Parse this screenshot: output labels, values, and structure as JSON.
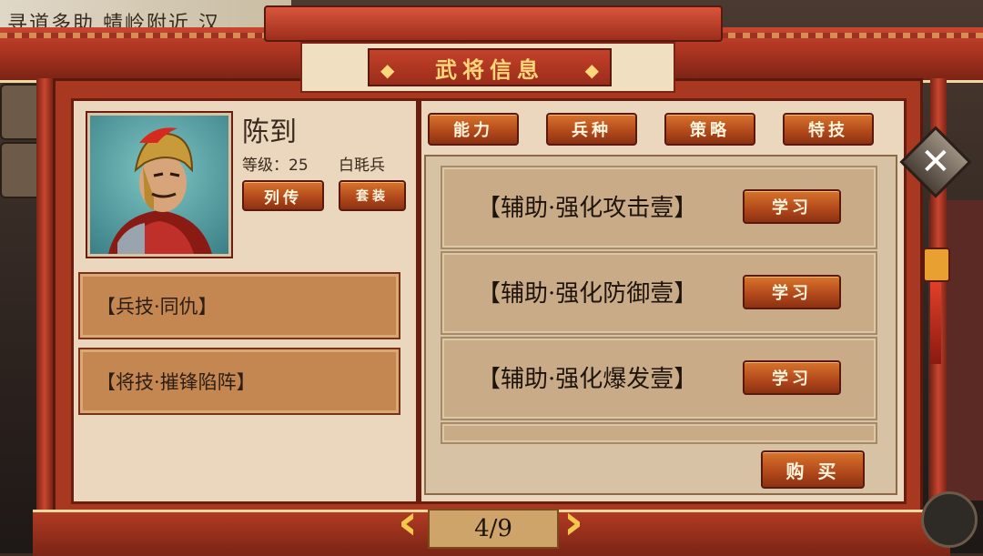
{
  "background": {
    "banner_text": "寻道多助  蜻岭附近  汉"
  },
  "window": {
    "title": "武将信息"
  },
  "general": {
    "name": "陈到",
    "level": "等级：25",
    "troop": "白毦兵",
    "bio_button": "列传",
    "suit_button": "套装"
  },
  "skills": [
    "【兵技·同仇】",
    "【将技·摧锋陷阵】"
  ],
  "tabs": [
    {
      "label": "能力"
    },
    {
      "label": "兵种"
    },
    {
      "label": "策略"
    },
    {
      "label": "特技"
    }
  ],
  "specials": [
    {
      "name": "【辅助·强化攻击壹】",
      "action": "学习"
    },
    {
      "name": "【辅助·强化防御壹】",
      "action": "学习"
    },
    {
      "name": "【辅助·强化爆发壹】",
      "action": "学习"
    }
  ],
  "buy_button": "购 买",
  "pager": {
    "label": "4/9"
  },
  "icons": {
    "close": "close-icon",
    "prev": "chevron-left-icon",
    "next": "chevron-right-icon"
  },
  "colors": {
    "frame_red": "#a8381f",
    "gold": "#ffd67a",
    "button_orange": "#b44a1c",
    "parchment": "#ead7bd"
  }
}
